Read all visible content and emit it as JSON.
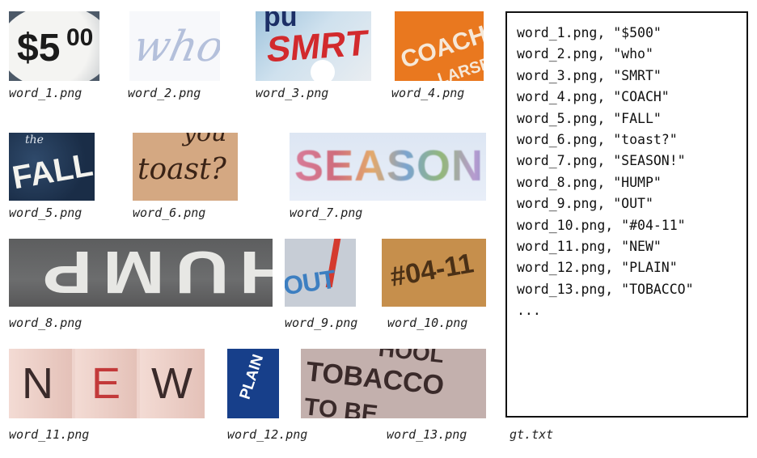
{
  "images": [
    {
      "file": "word_1.png",
      "text": "$5",
      "text_sup": "00"
    },
    {
      "file": "word_2.png",
      "text": "who"
    },
    {
      "file": "word_3.png",
      "text": "SMRT",
      "text_top": "pu"
    },
    {
      "file": "word_4.png",
      "text": "COACH",
      "text_sub": "LARSEN"
    },
    {
      "file": "word_5.png",
      "text": "FALL",
      "text_top": "the"
    },
    {
      "file": "word_6.png",
      "text": "toast?",
      "text_top": "you"
    },
    {
      "file": "word_7.png",
      "text": "SEASON!"
    },
    {
      "file": "word_8.png",
      "text": "HUMP"
    },
    {
      "file": "word_9.png",
      "text": "OUT"
    },
    {
      "file": "word_10.png",
      "text": "#04-11"
    },
    {
      "file": "word_11.png",
      "letters": [
        "N",
        "E",
        "W"
      ]
    },
    {
      "file": "word_12.png",
      "text": "PLAIN"
    },
    {
      "file": "word_13.png",
      "text": "TOBACCO",
      "text_top": "HOOL",
      "text_sub": "TO BE"
    }
  ],
  "gt": {
    "filename": "gt.txt",
    "lines": [
      "word_1.png, \"$500\"",
      "word_2.png, \"who\"",
      "word_3.png, \"SMRT\"",
      "word_4.png, \"COACH\"",
      "word_5.png, \"FALL\"",
      "word_6.png, \"toast?\"",
      "word_7.png, \"SEASON!\"",
      "word_8.png, \"HUMP\"",
      "word_9.png, \"OUT\"",
      "word_10.png, \"#04-11\"",
      "word_11.png, \"NEW\"",
      "word_12.png, \"PLAIN\"",
      "word_13.png, \"TOBACCO\"",
      "..."
    ]
  }
}
